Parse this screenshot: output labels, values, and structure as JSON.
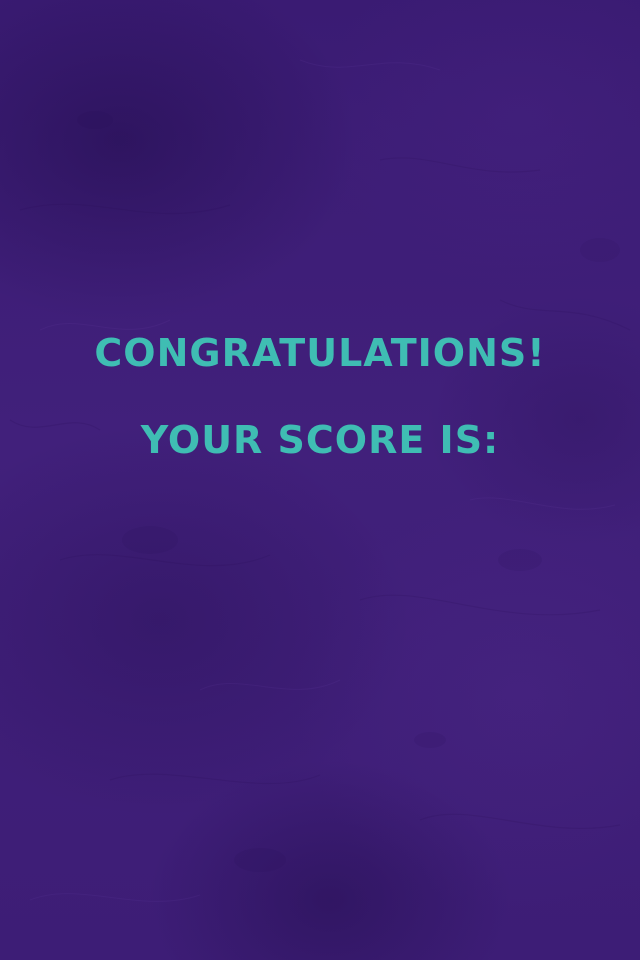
{
  "result_screen": {
    "congratulations_text": "CONGRATULATIONS!",
    "score_label_text": "YOUR SCORE IS:"
  },
  "colors": {
    "background": "#3f1f79",
    "text_accent": "#3fbdb3"
  }
}
